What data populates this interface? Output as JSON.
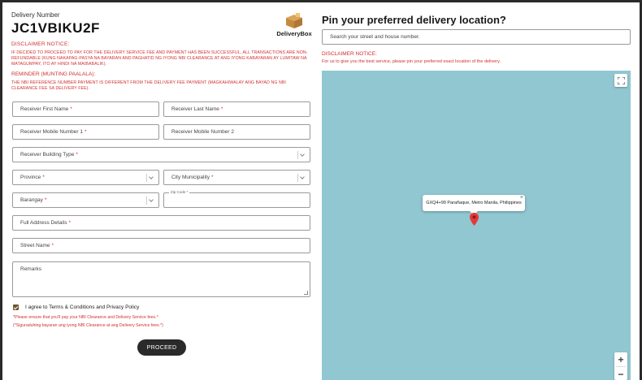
{
  "delivery": {
    "label": "Delivery Number",
    "number": "JC1VBIKU2F"
  },
  "logo": {
    "text": "DeliveryBox",
    "icon": "box-icon"
  },
  "disclaimer": {
    "title": "DISCLAIMER NOTICE:",
    "text": "IF DECIDED TO PROCEED TO PAY FOR THE DELIVERY SERVICE FEE AND PAYMENT HAS BEEN SUCCESSFUL, ALL TRANSACTIONS ARE NON-REFUNDABLE (KUNG NAKAPAG-PASYA NA BAYARAN AND PAGHATID NG IYONG NBI CLEARANCE AT ANG IYONG KABAYARAN AY LUMITAW NA MATAGUMPAY, ITO AY HINDI NA MAIBABALIK)."
  },
  "reminder": {
    "title": "REMINDER (MUNTING PAALALA):",
    "text": "THE NBI REFERENCE NUMBER PAYMENT IS DIFFERENT FROM THE DELIVERY FEE PAYMENT (MAGKAHIWALAY ANG BAYAD NG NBI CLEARANCE FEE SA DELIVERY FEE)."
  },
  "form": {
    "first_name": "Receiver First Name",
    "last_name": "Receiver Last Name",
    "mobile1": "Receiver Mobile Number 1",
    "mobile2": "Receiver Mobile Number 2",
    "building": "Receiver Building Type",
    "province": "Province",
    "city": "City Municipality",
    "barangay": "Barangay",
    "zip": "Zip Code",
    "full_address": "Full Address Details",
    "street": "Street Name",
    "remarks": "Remarks",
    "required_mark": "*"
  },
  "agree": {
    "text": "I agree to Terms & Conditions and Privacy Policy",
    "checked": true,
    "note1": "*Please ensure that you'll pay your NBI Clearance and Delivery Service fees.*",
    "note2": "(*Siguraduhing bayaran ang iyong NBI Clearance at ang Delivery Service fees.*)"
  },
  "proceed_label": "PROCEED",
  "right": {
    "title": "Pin your preferred delivery location?",
    "search_placeholder": "Search your street and house number.",
    "disclaimer_title": "DISCLAIMER NOTICE:",
    "disclaimer_text": "For us to give you the best service, please pin your preferred exact location of the delivery."
  },
  "map": {
    "popup_text": "GXQ4+99 Parañaque, Metro Manila, Philippines",
    "close": "×",
    "zoom_in": "+",
    "zoom_out": "−"
  },
  "colors": {
    "accent_red": "#d32f2f",
    "map_water": "#90c7d1",
    "button_dark": "#2a2a2a",
    "checkbox": "#6b5a2e"
  }
}
